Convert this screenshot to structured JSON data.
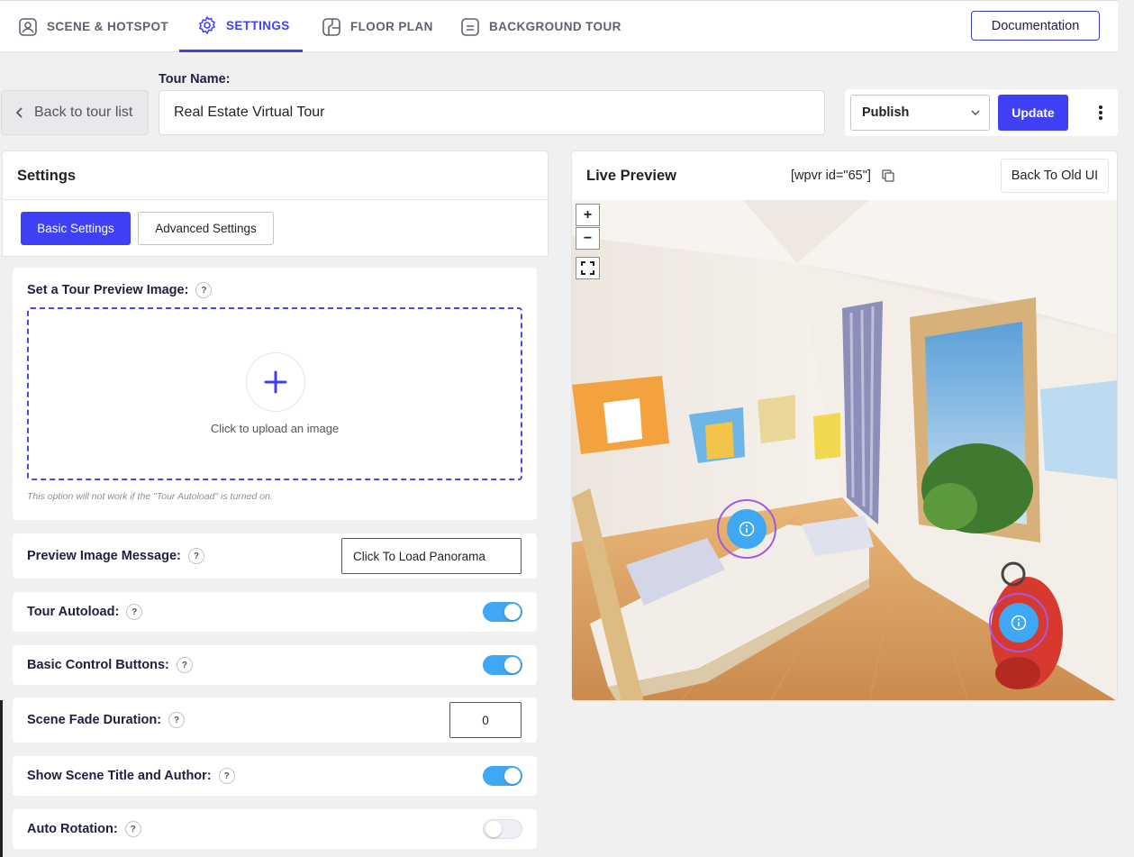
{
  "nav": {
    "tabs": [
      {
        "label": "SCENE & HOTSPOT",
        "icon": "scene-icon",
        "active": false
      },
      {
        "label": "SETTINGS",
        "icon": "gear-icon",
        "active": true
      },
      {
        "label": "FLOOR PLAN",
        "icon": "floor-plan-icon",
        "active": false
      },
      {
        "label": "BACKGROUND TOUR",
        "icon": "background-tour-icon",
        "active": false
      }
    ],
    "documentation_label": "Documentation"
  },
  "tour": {
    "back_label": "Back to tour list",
    "name_label": "Tour Name:",
    "name_value": "Real Estate Virtual Tour",
    "status_select": "Publish",
    "update_label": "Update"
  },
  "settings": {
    "title": "Settings",
    "tab_basic": "Basic Settings",
    "tab_advanced": "Advanced Settings",
    "preview_image": {
      "label": "Set a Tour Preview Image:",
      "upload_text": "Click to upload an image",
      "note": "This option will not work if the \"Tour Autoload\" is turned on."
    },
    "preview_message": {
      "label": "Preview Image Message:",
      "value": "Click To Load Panorama"
    },
    "autoload": {
      "label": "Tour Autoload:",
      "enabled": true
    },
    "control_buttons": {
      "label": "Basic Control Buttons:",
      "enabled": true
    },
    "fade_duration": {
      "label": "Scene Fade Duration:",
      "value": "0"
    },
    "scene_title": {
      "label": "Show Scene Title and Author:",
      "enabled": true
    },
    "auto_rotation": {
      "label": "Auto Rotation:",
      "enabled": false
    },
    "help_glyph": "?"
  },
  "preview": {
    "title": "Live Preview",
    "shortcode": "[wpvr id=\"65\"]",
    "old_ui_label": "Back To Old UI",
    "zoom_in": "+",
    "zoom_out": "−"
  },
  "colors": {
    "accent": "#3f3ff5",
    "toggle_on": "#3fa7f5",
    "hotspot": "#3ea8f4",
    "hotspot_ring": "#a35ae0"
  }
}
